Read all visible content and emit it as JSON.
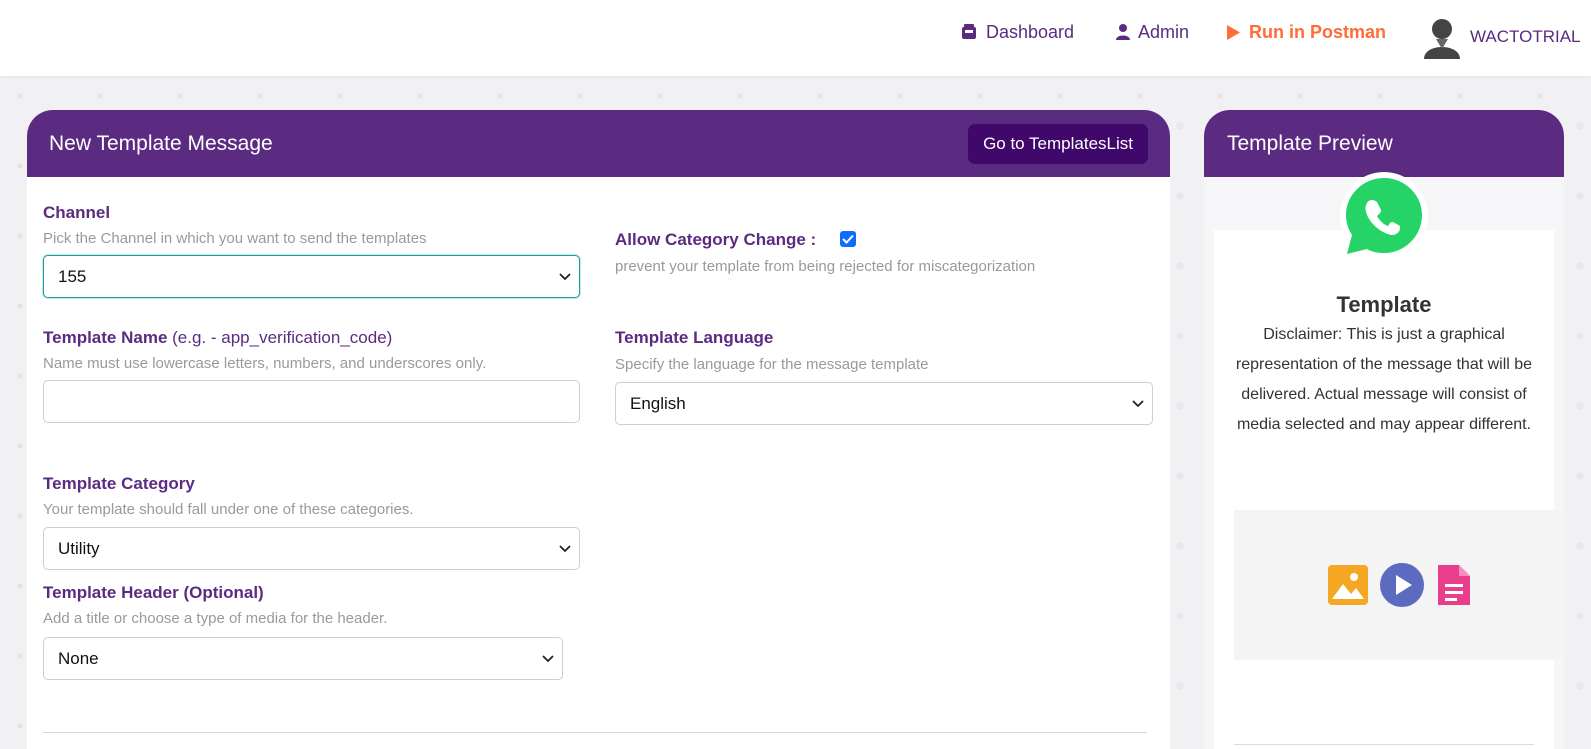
{
  "nav": {
    "dashboard": "Dashboard",
    "admin": "Admin",
    "postman": "Run in Postman",
    "user": "WACTOTRIAL"
  },
  "form": {
    "title": "New Template Message",
    "go_button": "Go to TemplatesList",
    "channel": {
      "label": "Channel",
      "help": "Pick the Channel in which you want to send the templates",
      "value": "155"
    },
    "allow_category": {
      "label": "Allow Category Change :",
      "help": "prevent your template from being rejected for miscategorization",
      "checked": true
    },
    "template_name": {
      "label": "Template Name",
      "label_hint": "(e.g. - app_verification_code)",
      "help": "Name must use lowercase letters, numbers, and underscores only.",
      "value": ""
    },
    "template_language": {
      "label": "Template Language",
      "help": "Specify the language for the message template",
      "value": "English"
    },
    "template_category": {
      "label": "Template Category",
      "help": "Your template should fall under one of these categories.",
      "value": "Utility"
    },
    "template_header": {
      "label": "Template Header (Optional)",
      "help": "Add a title or choose a type of media for the header.",
      "value": "None"
    }
  },
  "preview": {
    "title": "Template Preview",
    "heading": "Template",
    "disclaimer": "Disclaimer: This is just a graphical representation of the message that will be delivered. Actual message will consist of media selected and may appear different.",
    "media_icons": [
      "image-icon",
      "video-play-icon",
      "document-icon"
    ]
  },
  "colors": {
    "brand_purple": "#5b2b82",
    "button_dark_purple": "#40086b",
    "postman_orange": "#ff6c37",
    "whatsapp_green": "#25d366",
    "image_icon": "#f5a623",
    "video_icon": "#5c6bc0",
    "document_icon": "#e83e8c"
  }
}
